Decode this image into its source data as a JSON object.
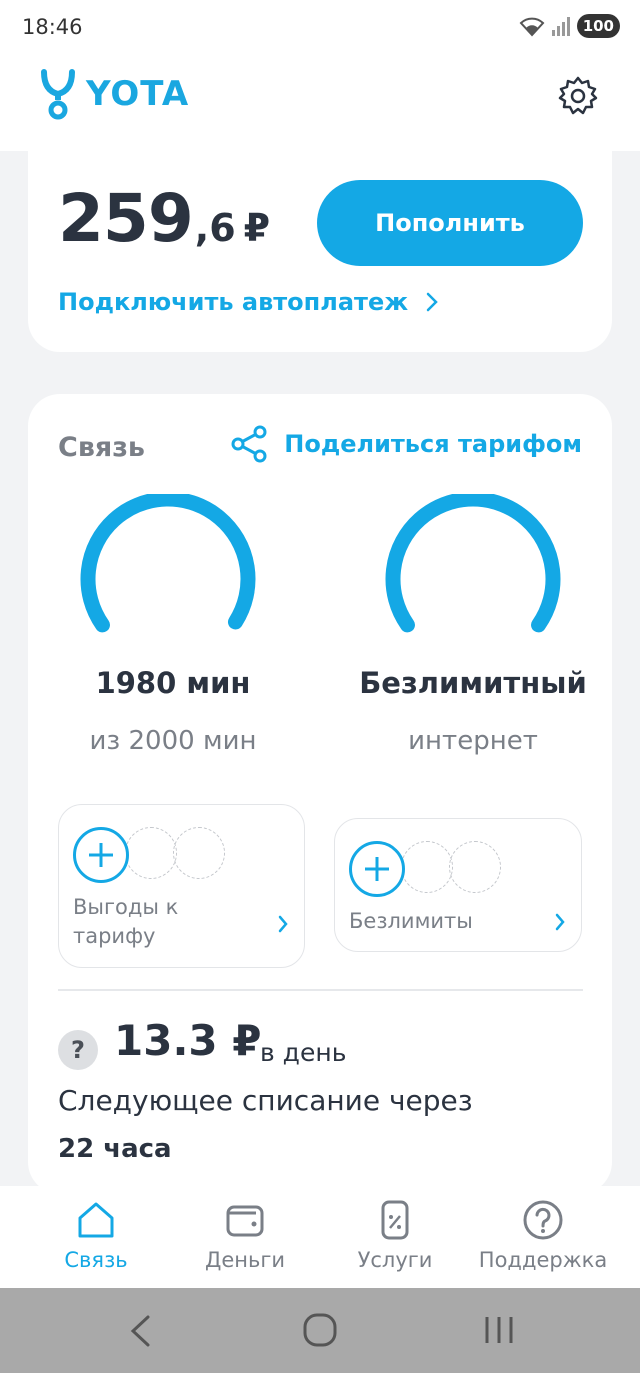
{
  "status_bar": {
    "time": "18:46",
    "battery": "100"
  },
  "header": {
    "logo_text": "YOTA",
    "settings_icon": "gear-icon"
  },
  "balance": {
    "integer": "259",
    "fraction": ",6",
    "currency": "₽",
    "topup_label": "Пополнить",
    "autopay_label": "Подключить автоплатеж"
  },
  "tariff": {
    "section_title": "Связь",
    "share_label": "Поделиться тарифом",
    "minutes": {
      "main": "1980 мин",
      "sub": "из 2000 мин",
      "fill_fraction": 0.99
    },
    "internet": {
      "main": "Безлимитный",
      "sub": "интернет",
      "fill_fraction": 1.0
    },
    "addons": [
      {
        "label": "Выгоды к тарифу"
      },
      {
        "label": "Безлимиты"
      }
    ],
    "daily_price": "13.3 ₽",
    "daily_unit": "в день",
    "next_charge_label": "Следующее списание через",
    "next_charge_time": "22 часа"
  },
  "bottom_nav": [
    {
      "label": "Связь",
      "icon": "home-icon",
      "active": true
    },
    {
      "label": "Деньги",
      "icon": "wallet-icon",
      "active": false
    },
    {
      "label": "Услуги",
      "icon": "services-icon",
      "active": false
    },
    {
      "label": "Поддержка",
      "icon": "help-icon",
      "active": false
    }
  ],
  "colors": {
    "accent": "#14a8e5",
    "text_dark": "#2b3340",
    "text_muted": "#7a7f87"
  }
}
